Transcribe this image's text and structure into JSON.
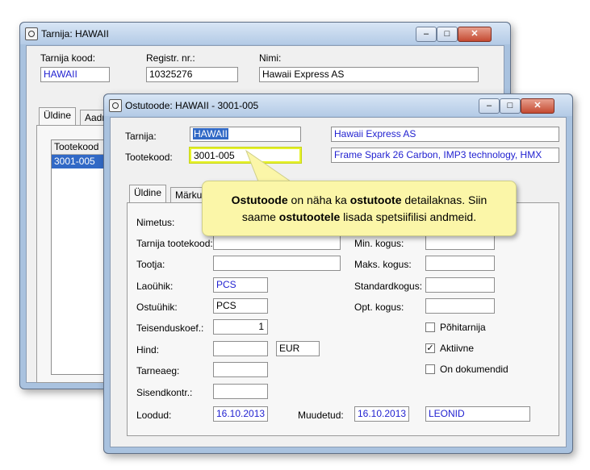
{
  "back_window": {
    "title": "Tarnija: HAWAII",
    "labels": {
      "supplier_code": "Tarnija kood:",
      "reg_nr": "Registr. nr.:",
      "name": "Nimi:"
    },
    "values": {
      "supplier_code": "HAWAII",
      "reg_nr": "10325276",
      "name": "Hawaii Express AS"
    },
    "tabs": [
      "Üldine",
      "Aadr"
    ],
    "list_header": "Tootekood",
    "list_item": "3001-005"
  },
  "front_window": {
    "title": "Ostutoode: HAWAII - 3001-005",
    "labels": {
      "supplier": "Tarnija:",
      "product_code": "Tootekood:"
    },
    "values": {
      "supplier": "HAWAII",
      "supplier_name": "Hawaii Express AS",
      "product_code": "3001-005",
      "product_desc": "Frame Spark 26 Carbon, IMP3 technology, HMX"
    },
    "tabs": [
      "Üldine",
      "Märku"
    ],
    "form": {
      "name_label": "Nimetus:",
      "supplier_code_label": "Tarnija tootekood:",
      "maker_label": "Tootja:",
      "stock_unit_label": "Laoühik:",
      "stock_unit": "PCS",
      "purchase_unit_label": "Ostuühik:",
      "purchase_unit": "PCS",
      "conv_label": "Teisenduskoef.:",
      "conv_value": "1",
      "price_label": "Hind:",
      "currency": "EUR",
      "lead_label": "Tarneaeg:",
      "input_ctrl_label": "Sisendkontr.:",
      "created_label": "Loodud:",
      "created_value": "16.10.2013",
      "modified_label": "Muudetud:",
      "modified_value": "16.10.2013",
      "modified_by": "LEONID",
      "min_qty_label": "Min. kogus:",
      "max_qty_label": "Maks. kogus:",
      "std_qty_label": "Standardkogus:",
      "opt_qty_label": "Opt. kogus:",
      "main_supplier_label": "Põhitarnija",
      "active_label": "Aktiivne",
      "on_docs_label": "On dokumendid",
      "active_check": "✓"
    }
  },
  "callout": {
    "line1_bold1": "Ostutoode",
    "line1_text": " on näha ka ",
    "line1_bold2": "ostutoote",
    "line1_text2": " detailaknas. Siin",
    "line2_text": "saame ",
    "line2_bold": "ostutootele",
    "line2_text2": " lisada spetsiifilisi andmeid."
  },
  "titlebar_glyphs": {
    "minimize": "–",
    "maximize": "□",
    "close": "✕"
  },
  "colors": {
    "highlight": "#e6f22a",
    "callout_bg": "#fbf6a8",
    "value_blue": "#1f1fd0",
    "selection": "#3169c6"
  }
}
